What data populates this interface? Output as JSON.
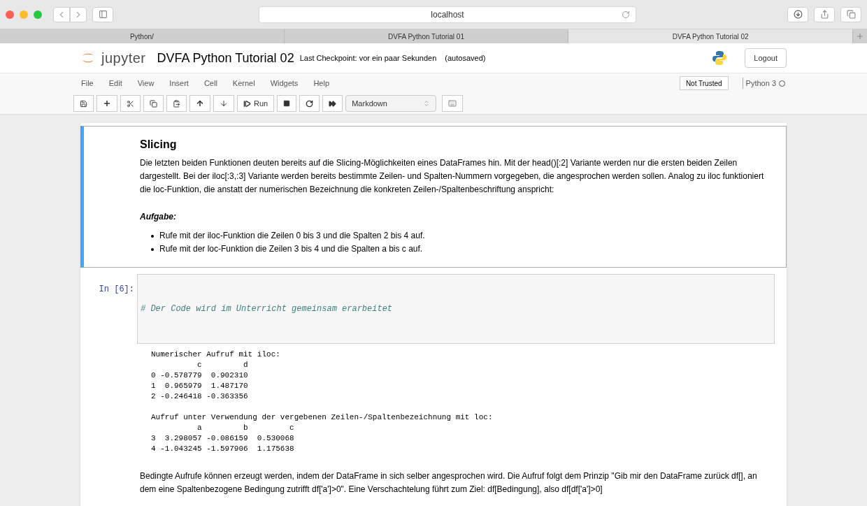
{
  "browser": {
    "address": "localhost",
    "tabs": [
      {
        "label": "Python/",
        "selected": false
      },
      {
        "label": "DVFA Python Tutorial 01",
        "selected": false
      },
      {
        "label": "DVFA Python Tutorial 02",
        "selected": true
      }
    ]
  },
  "header": {
    "logo_text": "jupyter",
    "title": "DVFA Python Tutorial 02",
    "checkpoint": "Last Checkpoint: vor ein paar Sekunden",
    "autosaved": "(autosaved)",
    "logout": "Logout"
  },
  "menu": [
    "File",
    "Edit",
    "View",
    "Insert",
    "Cell",
    "Kernel",
    "Widgets",
    "Help"
  ],
  "trust": "Not Trusted",
  "kernel": {
    "name": "Python 3",
    "busy": false
  },
  "toolbar": {
    "run_label": "Run",
    "cell_type": "Markdown"
  },
  "cells": [
    {
      "kind": "markdown",
      "selected": true,
      "heading": "Slicing",
      "paragraph": "Die letzten beiden Funktionen deuten bereits auf die Slicing-Möglichkeiten eines DataFrames hin. Mit der head()[:2] Variante werden nur die ersten beiden Zeilen dargestellt. Bei der iloc[:3,:3] Variante werden bereits bestimmte Zeilen- und Spalten-Nummern vorgegeben, die angesprochen werden sollen. Analog zu iloc funktioniert die loc-Funktion, die anstatt der numerischen Bezeichnung die konkreten Zeilen-/Spaltenbeschriftung anspricht:",
      "subheading": "Aufgabe:",
      "bullets": [
        "Rufe mit der iloc-Funktion die Zeilen 0 bis 3 und die Spalten 2 bis 4 auf.",
        "Rufe mit der loc-Funktion die Zeilen 3 bis 4 und die Spalten a bis c auf."
      ]
    },
    {
      "kind": "code",
      "selected": false,
      "prompt": "In [6]:",
      "code": "# Der Code wird im Unterricht gemeinsam erarbeitet",
      "output": [
        [
          "Numerischer Aufruf mit iloc:",
          "          c         d",
          "0 -0.578779  0.902310",
          "1  0.965979  1.487170",
          "2 -0.246418 -0.363356"
        ],
        [
          "Aufruf unter Verwendung der vergebenen Zeilen-/Spaltenbezeichnung mit loc:",
          "          a         b         c",
          "3  3.298057 -0.086159  0.530068",
          "4 -1.043245 -1.597906  1.175638"
        ]
      ]
    },
    {
      "kind": "markdown",
      "selected": false,
      "paragraph": "Bedingte Aufrufe können erzeugt werden, indem der DataFrame in sich selber angesprochen wird. Die Aufruf folgt dem Prinzip \"Gib mir den DataFrame zurück df[], an dem eine Spaltenbezogene Bedingung zutrifft df['a']>0\". Eine Verschachtelung führt zum Ziel: df[Bedingung], also df[df['a']>0]"
    }
  ]
}
